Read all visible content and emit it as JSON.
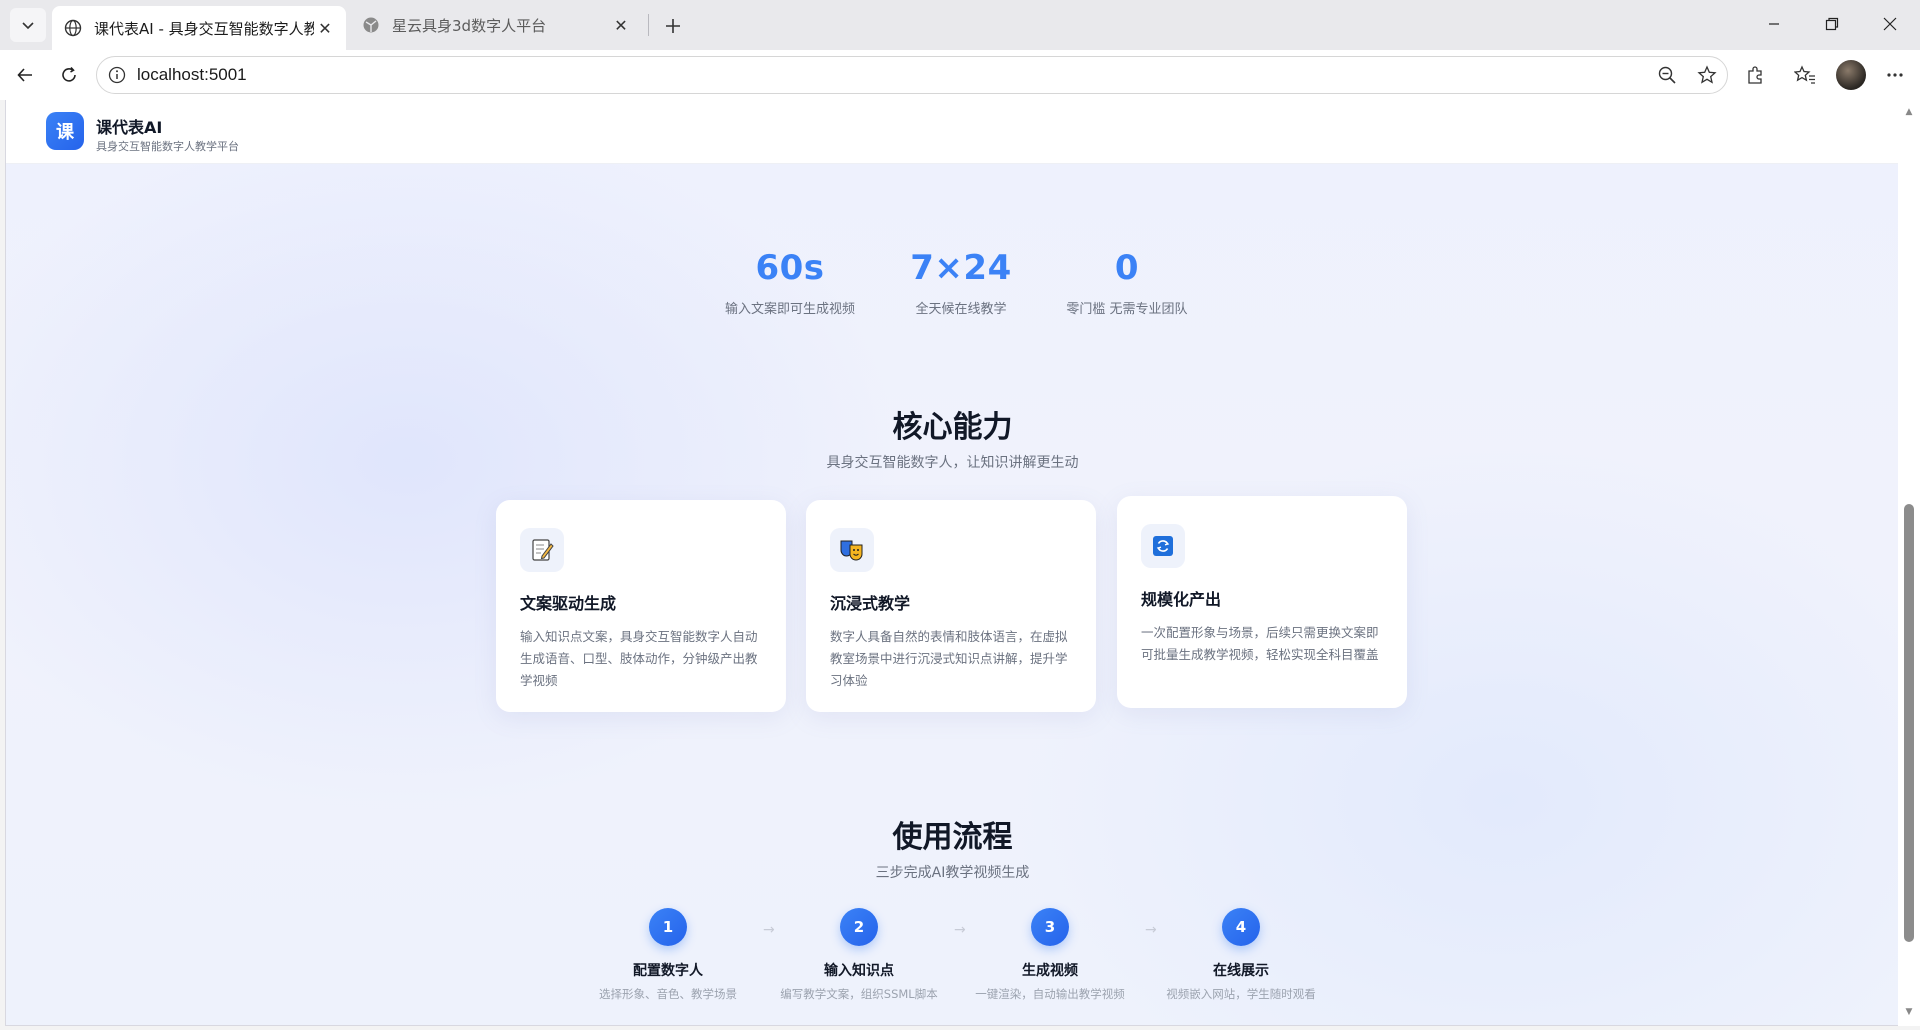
{
  "browser": {
    "tabs": [
      {
        "title": "课代表AI - 具身交互智能数字人教学",
        "active": true,
        "icon": "globe-icon"
      },
      {
        "title": "星云具身3d数字人平台",
        "active": false,
        "icon": "globe-icon"
      }
    ],
    "address": "localhost:5001"
  },
  "site": {
    "logo_char": "课",
    "name": "课代表AI",
    "tagline": "具身交互智能数字人教学平台"
  },
  "stats": [
    {
      "value": "60s",
      "label": "输入文案即可生成视频"
    },
    {
      "value": "7×24",
      "label": "全天候在线教学"
    },
    {
      "value": "0",
      "label": "零门槛 无需专业团队"
    }
  ],
  "core": {
    "title": "核心能力",
    "subtitle": "具身交互智能数字人，让知识讲解更生动",
    "cards": [
      {
        "icon": "memo-icon",
        "title": "文案驱动生成",
        "desc": "输入知识点文案，具身交互智能数字人自动生成语音、口型、肢体动作，分钟级产出教学视频"
      },
      {
        "icon": "performing-arts-icon",
        "title": "沉浸式教学",
        "desc": "数字人具备自然的表情和肢体语言，在虚拟教室场景中进行沉浸式知识点讲解，提升学习体验"
      },
      {
        "icon": "refresh-icon",
        "title": "规模化产出",
        "desc": "一次配置形象与场景，后续只需更换文案即可批量生成教学视频，轻松实现全科目覆盖"
      }
    ]
  },
  "flow": {
    "title": "使用流程",
    "subtitle": "三步完成AI教学视频生成",
    "arrow": "→",
    "steps": [
      {
        "num": "1",
        "title": "配置数字人",
        "desc": "选择形象、音色、教学场景"
      },
      {
        "num": "2",
        "title": "输入知识点",
        "desc": "编写教学文案，组织SSML脚本"
      },
      {
        "num": "3",
        "title": "生成视频",
        "desc": "一键渲染，自动输出教学视频"
      },
      {
        "num": "4",
        "title": "在线展示",
        "desc": "视频嵌入网站，学生随时观看"
      }
    ]
  }
}
